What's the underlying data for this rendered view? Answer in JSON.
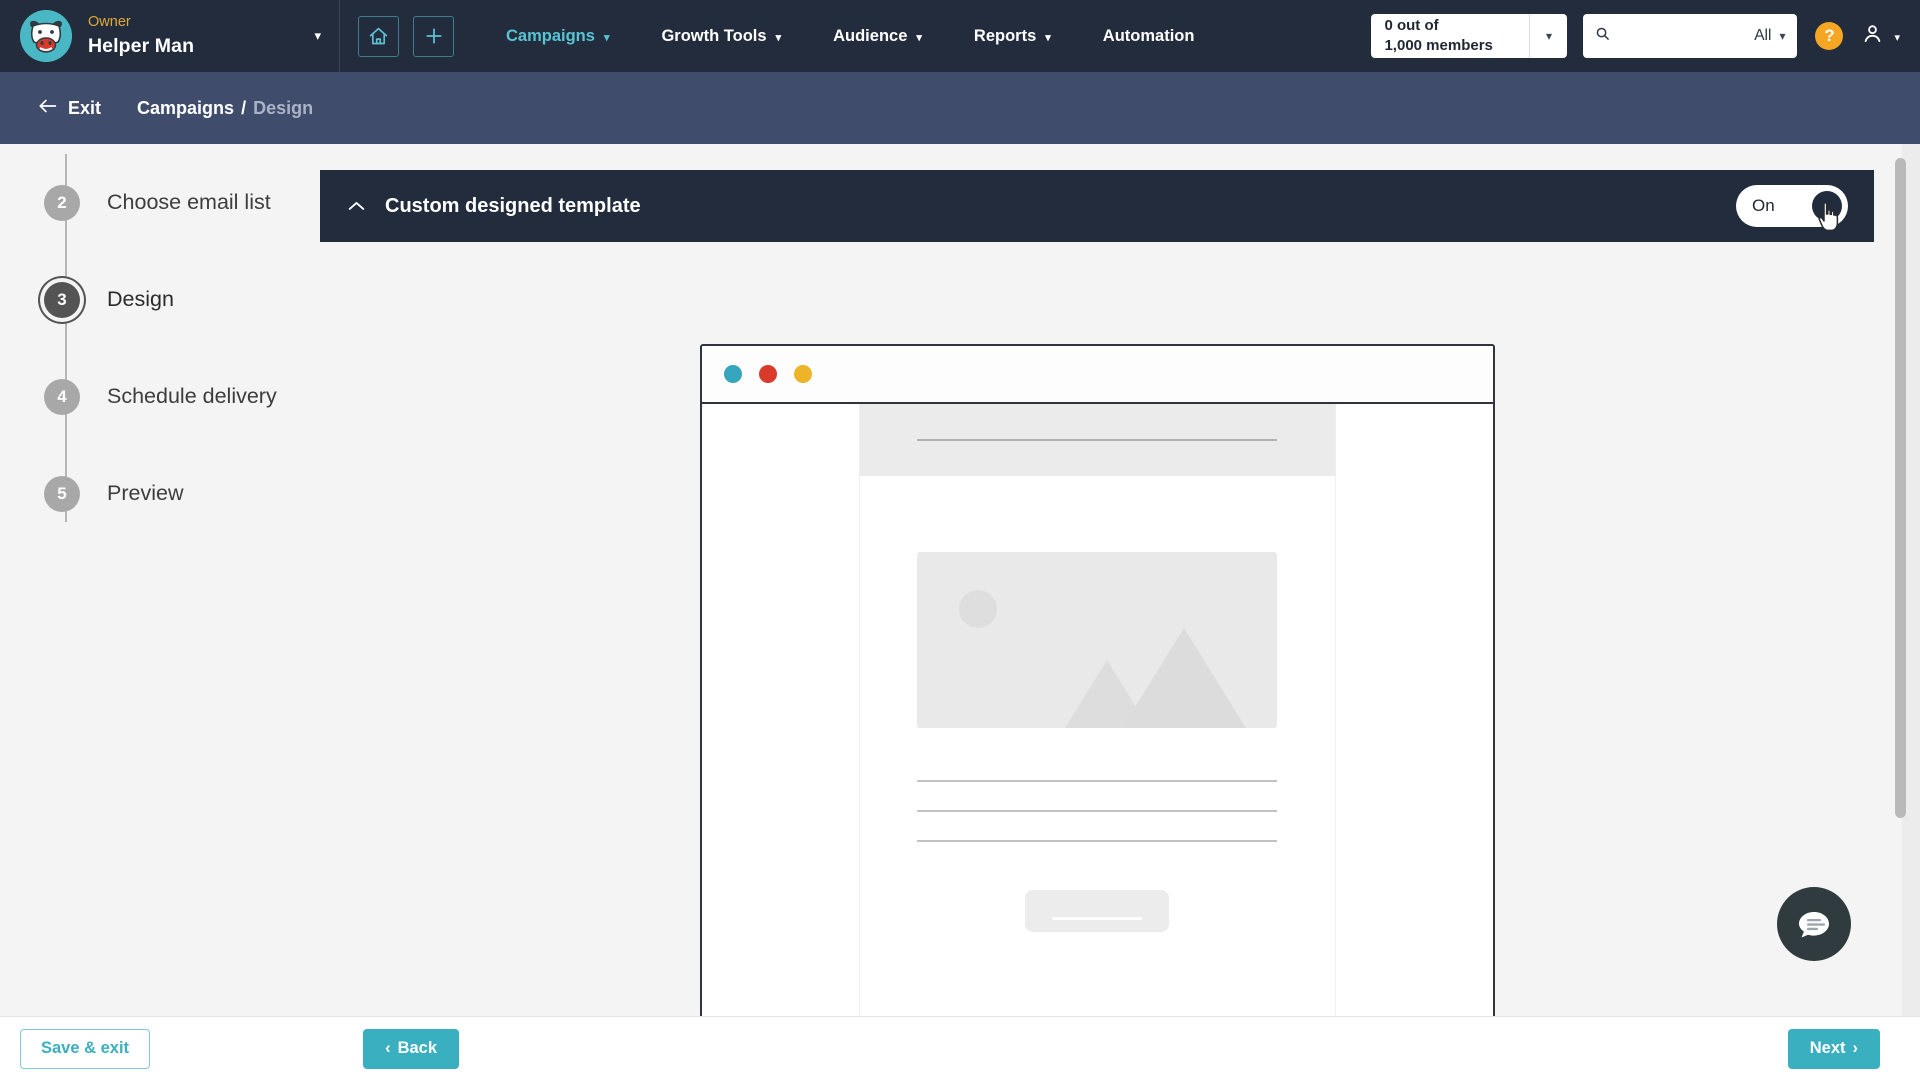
{
  "topnav": {
    "brand": {
      "role": "Owner",
      "name": "Helper Man",
      "avatar_icon": "cow-mascot-avatar",
      "caret_icon": "chevron-down-icon"
    },
    "home_icon": "home-icon",
    "add_icon": "plus-icon",
    "links": [
      {
        "label": "Campaigns",
        "has_caret": true,
        "active": true
      },
      {
        "label": "Growth Tools",
        "has_caret": true,
        "active": false
      },
      {
        "label": "Audience",
        "has_caret": true,
        "active": false
      },
      {
        "label": "Reports",
        "has_caret": true,
        "active": false
      },
      {
        "label": "Automation",
        "has_caret": false,
        "active": false
      }
    ],
    "member_select": {
      "line1": "0 out of",
      "line2": "1,000 members",
      "caret_icon": "chevron-down-icon"
    },
    "search": {
      "value": "",
      "placeholder": "",
      "scope": "All",
      "icon": "search-icon",
      "caret_icon": "chevron-down-icon"
    },
    "help_badge": "?",
    "account_icon": "user-icon",
    "account_caret_icon": "chevron-down-icon"
  },
  "crumbbar": {
    "exit_label": "Exit",
    "exit_icon": "arrow-left-icon",
    "crumb_parent": "Campaigns",
    "crumb_sep": "/",
    "crumb_current": "Design"
  },
  "sidebar": {
    "steps": [
      {
        "num": "2",
        "label": "Choose email list",
        "active": false
      },
      {
        "num": "3",
        "label": "Design",
        "active": true
      },
      {
        "num": "4",
        "label": "Schedule delivery",
        "active": false
      },
      {
        "num": "5",
        "label": "Preview",
        "active": false
      }
    ]
  },
  "panel": {
    "collapse_icon": "chevron-up-icon",
    "title": "Custom designed template",
    "toggle": {
      "label": "On",
      "state": "on"
    }
  },
  "preview": {
    "window_dots": [
      "#35a6bd",
      "#d93a2b",
      "#edb429"
    ],
    "image_placeholder_icon": "image-placeholder-icon",
    "text_line_count": 3
  },
  "chat": {
    "icon": "chat-bubble-icon"
  },
  "footer": {
    "save_exit_label": "Save & exit",
    "back_label": "Back",
    "back_icon": "chevron-left-icon",
    "next_label": "Next",
    "next_icon": "chevron-right-icon"
  },
  "colors": {
    "nav_bg": "#232c3d",
    "crumb_bg": "#3f4c6b",
    "accent_teal": "#3aafc0",
    "accent_gold": "#e0a83a",
    "help_orange": "#f5a623"
  }
}
